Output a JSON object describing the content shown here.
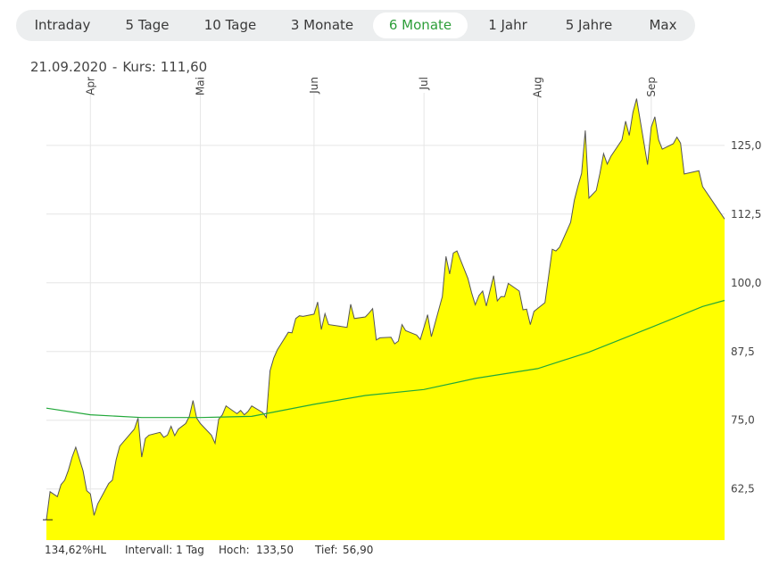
{
  "tabs": [
    "Intraday",
    "5 Tage",
    "10 Tage",
    "3 Monate",
    "6 Monate",
    "1 Jahr",
    "5 Jahre",
    "Max"
  ],
  "active_tab": "6 Monate",
  "info": {
    "date": "21.09.2020",
    "separator": "-",
    "price_label": "Kurs: 111,60"
  },
  "footer": {
    "hl": "134,62%HL",
    "interval_label": "Intervall: 1 Tag",
    "high_label": "Hoch:",
    "high_value": "133,50",
    "low_label": "Tief:",
    "low_value": "56,90"
  },
  "colors": {
    "area_fill": "#ffff00",
    "price_line": "#555555",
    "ma_line": "#22a83a",
    "active_tab_text": "#2e9e3a",
    "grid": "#e6e6e6"
  },
  "chart_data": {
    "type": "area",
    "x_range": [
      "2020-03-20",
      "2020-09-21"
    ],
    "xlabels": [
      {
        "label": "Apr",
        "date": "2020-04-01"
      },
      {
        "label": "Mai",
        "date": "2020-05-01"
      },
      {
        "label": "Jun",
        "date": "2020-06-01"
      },
      {
        "label": "Jul",
        "date": "2020-07-01"
      },
      {
        "label": "Aug",
        "date": "2020-08-01"
      },
      {
        "label": "Sep",
        "date": "2020-09-01"
      }
    ],
    "yticks": [
      {
        "value": 62.5,
        "label": "62,5"
      },
      {
        "value": 75.0,
        "label": "75,0"
      },
      {
        "value": 87.5,
        "label": "87,5"
      },
      {
        "value": 100.0,
        "label": "100,0"
      },
      {
        "value": 112.5,
        "label": "112,5"
      },
      {
        "value": 125.0,
        "label": "125,0"
      }
    ],
    "ylim": [
      53.2,
      137.8
    ],
    "y_axis_position": "right",
    "grid": true,
    "series": [
      {
        "role": "price",
        "points": [
          [
            "2020-03-20",
            56.9
          ],
          [
            "2020-03-21",
            62.0
          ],
          [
            "2020-03-23",
            61.1
          ],
          [
            "2020-03-24",
            63.3
          ],
          [
            "2020-03-25",
            64.1
          ],
          [
            "2020-03-26",
            65.9
          ],
          [
            "2020-03-27",
            68.3
          ],
          [
            "2020-03-28",
            70.1
          ],
          [
            "2020-03-30",
            65.8
          ],
          [
            "2020-03-31",
            62.2
          ],
          [
            "2020-04-01",
            61.6
          ],
          [
            "2020-04-02",
            57.7
          ],
          [
            "2020-04-03",
            59.8
          ],
          [
            "2020-04-06",
            63.5
          ],
          [
            "2020-04-07",
            64.1
          ],
          [
            "2020-04-08",
            67.8
          ],
          [
            "2020-04-09",
            70.3
          ],
          [
            "2020-04-13",
            73.4
          ],
          [
            "2020-04-14",
            75.4
          ],
          [
            "2020-04-15",
            68.3
          ],
          [
            "2020-04-16",
            71.7
          ],
          [
            "2020-04-17",
            72.3
          ],
          [
            "2020-04-20",
            72.8
          ],
          [
            "2020-04-21",
            71.9
          ],
          [
            "2020-04-22",
            72.3
          ],
          [
            "2020-04-23",
            73.9
          ],
          [
            "2020-04-24",
            72.2
          ],
          [
            "2020-04-25",
            73.4
          ],
          [
            "2020-04-27",
            74.4
          ],
          [
            "2020-04-28",
            75.7
          ],
          [
            "2020-04-29",
            78.6
          ],
          [
            "2020-04-30",
            75.4
          ],
          [
            "2020-05-01",
            74.4
          ],
          [
            "2020-05-04",
            72.3
          ],
          [
            "2020-05-05",
            70.8
          ],
          [
            "2020-05-06",
            75.2
          ],
          [
            "2020-05-07",
            76.0
          ],
          [
            "2020-05-08",
            77.6
          ],
          [
            "2020-05-11",
            76.2
          ],
          [
            "2020-05-12",
            76.8
          ],
          [
            "2020-05-13",
            76.0
          ],
          [
            "2020-05-14",
            76.6
          ],
          [
            "2020-05-15",
            77.6
          ],
          [
            "2020-05-18",
            76.4
          ],
          [
            "2020-05-19",
            75.5
          ],
          [
            "2020-05-20",
            84.0
          ],
          [
            "2020-05-21",
            86.3
          ],
          [
            "2020-05-22",
            87.8
          ],
          [
            "2020-05-25",
            91.0
          ],
          [
            "2020-05-26",
            90.9
          ],
          [
            "2020-05-27",
            93.5
          ],
          [
            "2020-05-28",
            94.0
          ],
          [
            "2020-05-29",
            93.9
          ],
          [
            "2020-06-01",
            94.3
          ],
          [
            "2020-06-02",
            96.5
          ],
          [
            "2020-06-03",
            91.5
          ],
          [
            "2020-06-04",
            94.4
          ],
          [
            "2020-06-05",
            92.4
          ],
          [
            "2020-06-08",
            92.1
          ],
          [
            "2020-06-10",
            91.9
          ],
          [
            "2020-06-11",
            96.1
          ],
          [
            "2020-06-12",
            93.5
          ],
          [
            "2020-06-15",
            93.8
          ],
          [
            "2020-06-16",
            94.5
          ],
          [
            "2020-06-17",
            95.3
          ],
          [
            "2020-06-18",
            89.6
          ],
          [
            "2020-06-19",
            90.0
          ],
          [
            "2020-06-22",
            90.1
          ],
          [
            "2020-06-23",
            88.9
          ],
          [
            "2020-06-24",
            89.4
          ],
          [
            "2020-06-25",
            92.4
          ],
          [
            "2020-06-26",
            91.3
          ],
          [
            "2020-06-29",
            90.5
          ],
          [
            "2020-06-30",
            89.7
          ],
          [
            "2020-07-01",
            91.9
          ],
          [
            "2020-07-02",
            94.2
          ],
          [
            "2020-07-03",
            90.2
          ],
          [
            "2020-07-06",
            97.5
          ],
          [
            "2020-07-07",
            104.8
          ],
          [
            "2020-07-08",
            101.6
          ],
          [
            "2020-07-09",
            105.4
          ],
          [
            "2020-07-10",
            105.8
          ],
          [
            "2020-07-13",
            100.8
          ],
          [
            "2020-07-14",
            98.2
          ],
          [
            "2020-07-15",
            96.0
          ],
          [
            "2020-07-16",
            97.7
          ],
          [
            "2020-07-17",
            98.5
          ],
          [
            "2020-07-18",
            95.8
          ],
          [
            "2020-07-20",
            101.3
          ],
          [
            "2020-07-21",
            96.7
          ],
          [
            "2020-07-22",
            97.5
          ],
          [
            "2020-07-23",
            97.5
          ],
          [
            "2020-07-24",
            99.9
          ],
          [
            "2020-07-27",
            98.5
          ],
          [
            "2020-07-28",
            95.1
          ],
          [
            "2020-07-29",
            95.2
          ],
          [
            "2020-07-30",
            92.4
          ],
          [
            "2020-07-31",
            94.8
          ],
          [
            "2020-08-03",
            96.4
          ],
          [
            "2020-08-04",
            101.2
          ],
          [
            "2020-08-05",
            106.1
          ],
          [
            "2020-08-06",
            105.8
          ],
          [
            "2020-08-07",
            106.5
          ],
          [
            "2020-08-10",
            111.0
          ],
          [
            "2020-08-11",
            115.0
          ],
          [
            "2020-08-12",
            117.6
          ],
          [
            "2020-08-13",
            119.9
          ],
          [
            "2020-08-14",
            127.7
          ],
          [
            "2020-08-15",
            115.4
          ],
          [
            "2020-08-17",
            116.8
          ],
          [
            "2020-08-18",
            119.9
          ],
          [
            "2020-08-19",
            123.5
          ],
          [
            "2020-08-20",
            121.6
          ],
          [
            "2020-08-21",
            123.0
          ],
          [
            "2020-08-24",
            126.0
          ],
          [
            "2020-08-25",
            129.4
          ],
          [
            "2020-08-26",
            126.8
          ],
          [
            "2020-08-27",
            131.0
          ],
          [
            "2020-08-28",
            133.5
          ],
          [
            "2020-08-31",
            121.5
          ],
          [
            "2020-09-01",
            128.3
          ],
          [
            "2020-09-02",
            130.2
          ],
          [
            "2020-09-03",
            126.0
          ],
          [
            "2020-09-04",
            124.3
          ],
          [
            "2020-09-07",
            125.3
          ],
          [
            "2020-09-08",
            126.5
          ],
          [
            "2020-09-09",
            125.4
          ],
          [
            "2020-09-10",
            119.8
          ],
          [
            "2020-09-14",
            120.4
          ],
          [
            "2020-09-15",
            117.5
          ],
          [
            "2020-09-21",
            111.6
          ]
        ]
      },
      {
        "role": "moving-average",
        "points": [
          [
            "2020-03-20",
            77.2
          ],
          [
            "2020-04-01",
            76.0
          ],
          [
            "2020-04-15",
            75.5
          ],
          [
            "2020-05-01",
            75.5
          ],
          [
            "2020-05-15",
            75.7
          ],
          [
            "2020-06-01",
            77.9
          ],
          [
            "2020-06-15",
            79.5
          ],
          [
            "2020-07-01",
            80.6
          ],
          [
            "2020-07-15",
            82.6
          ],
          [
            "2020-08-01",
            84.4
          ],
          [
            "2020-08-15",
            87.4
          ],
          [
            "2020-09-01",
            91.9
          ],
          [
            "2020-09-15",
            95.7
          ],
          [
            "2020-09-21",
            96.8
          ]
        ]
      }
    ]
  }
}
